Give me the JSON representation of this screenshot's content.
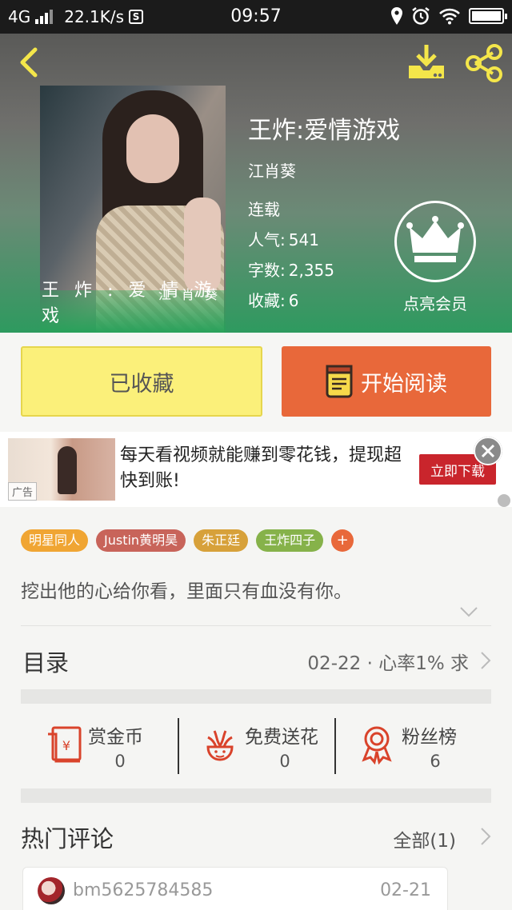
{
  "status_bar": {
    "network": "4G",
    "speed": "22.1K/s",
    "s_badge": "S",
    "time": "09:57"
  },
  "header": {
    "icons": [
      "back-icon",
      "download-icon",
      "share-icon"
    ],
    "cover": {
      "title_art": "王 炸 : 爱 情 游 戏",
      "author_art": "江 肖 葵"
    },
    "title": "王炸:爱情游戏",
    "author": "江肖葵",
    "status": "连载",
    "popularity_label": "人气:",
    "popularity_value": "541",
    "wordcount_label": "字数:",
    "wordcount_value": "2,355",
    "favorites_label": "收藏:",
    "favorites_value": "6",
    "vip_label": "点亮会员"
  },
  "actions": {
    "collected_label": "已收藏",
    "read_label": "开始阅读"
  },
  "ad": {
    "tag": "广告",
    "text": "每天看视频就能赚到零花钱，提现超快到账!",
    "cta": "立即下载"
  },
  "tags": [
    {
      "label": "明星同人",
      "color": "#f0a533"
    },
    {
      "label": "Justin黄明昊",
      "color": "#c8645a"
    },
    {
      "label": "朱正廷",
      "color": "#d7a13a"
    },
    {
      "label": "王炸四子",
      "color": "#86b24a"
    },
    {
      "label": "+",
      "color": "#e8683a"
    }
  ],
  "synopsis": "挖出他的心给你看，里面只有血没有你。",
  "catalog": {
    "title": "目录",
    "latest": "02-22 · 心率1% 求"
  },
  "support": [
    {
      "icon": "red-envelope-icon",
      "label": "赏金币",
      "count": "0"
    },
    {
      "icon": "flower-icon",
      "label": "免费送花",
      "count": "0"
    },
    {
      "icon": "medal-icon",
      "label": "粉丝榜",
      "count": "6"
    }
  ],
  "hot_comments": {
    "title": "热门评论",
    "all_label": "全部(1)",
    "first": {
      "user": "bm5625784585",
      "date": "02-21"
    }
  },
  "colors": {
    "accent_orange": "#e8683a",
    "collect_yellow": "#fbf07a",
    "icon_red": "#d9432b",
    "header_green": "#2e9a5f"
  }
}
